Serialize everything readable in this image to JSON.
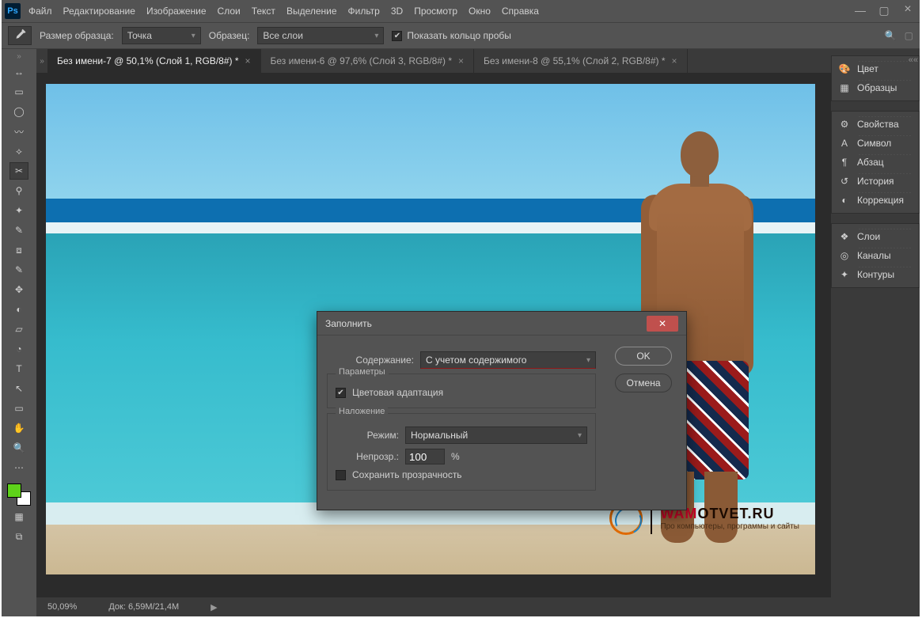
{
  "menu": {
    "file": "Файл",
    "edit": "Редактирование",
    "image": "Изображение",
    "layer": "Слои",
    "text": "Текст",
    "select": "Выделение",
    "filter": "Фильтр",
    "threeD": "3D",
    "view": "Просмотр",
    "window": "Окно",
    "help": "Справка"
  },
  "optbar": {
    "sampleSizeLabel": "Размер образца:",
    "sampleSizeValue": "Точка",
    "sampleLabel": "Образец:",
    "sampleValue": "Все слои",
    "showRingLabel": "Показать кольцо пробы"
  },
  "tabs": {
    "dots": "»",
    "items": [
      {
        "label": "Без имени-7 @ 50,1% (Слой 1, RGB/8#) *",
        "active": true
      },
      {
        "label": "Без имени-6 @ 97,6% (Слой 3, RGB/8#) *",
        "active": false
      },
      {
        "label": "Без имени-8 @ 55,1% (Слой 2, RGB/8#) *",
        "active": false
      }
    ],
    "rightdots": "««"
  },
  "dialog": {
    "title": "Заполнить",
    "contentLabel": "Содержание:",
    "contentValue": "С учетом содержимого",
    "groupParams": "Параметры",
    "colorAdapt": "Цветовая адаптация",
    "groupBlend": "Наложение",
    "modeLabel": "Режим:",
    "modeValue": "Нормальный",
    "opacityLabel": "Непрозр.:",
    "opacityValue": "100",
    "opacitySuffix": "%",
    "preserveTrans": "Сохранить прозрачность",
    "ok": "OK",
    "cancel": "Отмена"
  },
  "toolbar": {
    "icons": [
      "↔",
      "▭",
      "◯",
      "〰",
      "⟡",
      "✂",
      "⚲",
      "✦",
      "✎",
      "⧈",
      "✎",
      "✥",
      "◐",
      "▱",
      "◔",
      "⟀",
      "⤴",
      "●",
      "T",
      "↖",
      "▭",
      "✋",
      "🔍",
      "⋯"
    ]
  },
  "panels": {
    "color": "Цвет",
    "swatches": "Образцы",
    "properties": "Свойства",
    "character": "Символ",
    "paragraph": "Абзац",
    "history": "История",
    "adjust": "Коррекция",
    "layers": "Слои",
    "channels": "Каналы",
    "paths": "Контуры"
  },
  "status": {
    "zoom": "50,09%",
    "docLabel": "Док:",
    "docValue": "6,59M/21,4M",
    "arrow": "▶"
  },
  "watermark": {
    "line1a": "WAM",
    "line1b": "OTVET.RU",
    "line2": "Про компьютеры, программы и сайты"
  },
  "colors": {
    "foreground": "#5ed21a",
    "background": "#ffffff"
  },
  "ps": "Ps"
}
